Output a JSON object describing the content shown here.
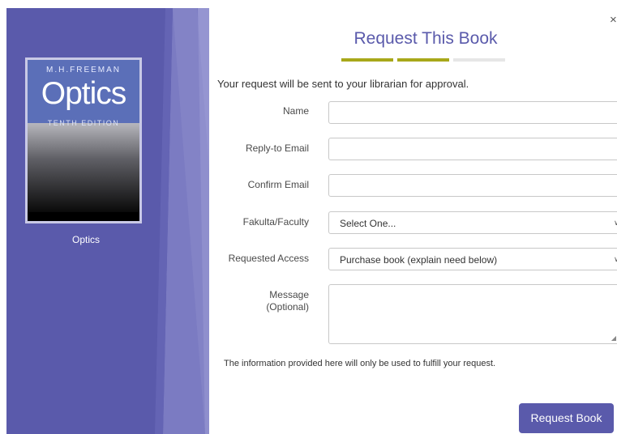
{
  "book": {
    "cover_author": "M.H.FREEMAN",
    "cover_title": "Optics",
    "cover_edition": "TENTH EDITION",
    "caption": "Optics"
  },
  "dialog": {
    "close_label": "×",
    "title": "Request This Book",
    "steps_total": 3,
    "steps_completed": 2,
    "intro": "Your request will be sent to your librarian for approval."
  },
  "form": {
    "name_label": "Name",
    "name_value": "",
    "reply_email_label": "Reply-to Email",
    "reply_email_value": "",
    "confirm_email_label": "Confirm Email",
    "confirm_email_value": "",
    "faculty_label": "Fakulta/Faculty",
    "faculty_value": "Select One...",
    "access_label": "Requested Access",
    "access_value": "Purchase book (explain need below)",
    "message_label_line1": "Message",
    "message_label_line2": "(Optional)",
    "message_value": "",
    "privacy_note": "The information provided here will only be used to fulfill your request.",
    "submit_label": "Request Book"
  },
  "colors": {
    "accent": "#5a5aab",
    "progress_done": "#a8a81a",
    "progress_todo": "#e6e6e6",
    "panel_stripe_light": "#8585c8",
    "panel_stripe_dark": "#4b4b96"
  },
  "icons": {
    "close": "close-icon",
    "select_arrow": "chevron-down-icon",
    "resize": "resize-grip-icon"
  }
}
